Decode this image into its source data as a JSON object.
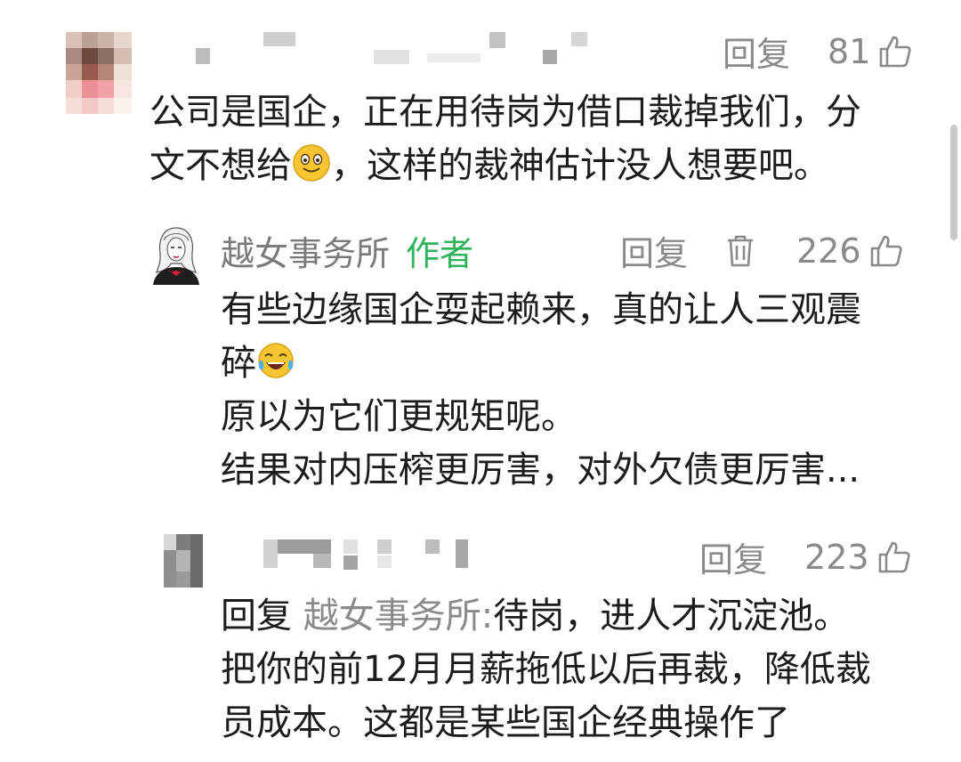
{
  "comment1": {
    "reply_label": "回复",
    "likes": "81",
    "text_line1": "公司是国企，正在用待岗为借口裁掉我们，分",
    "text_line2_a": "文不想给",
    "text_line2_b": "，这样的裁神估计没人想要吧。"
  },
  "comment2": {
    "author_name": "越女事务所",
    "author_tag": "作者",
    "reply_label": "回复",
    "likes": "226",
    "line1": "有些边缘国企耍起赖来，真的让人三观震",
    "line2": "碎",
    "line3": "原以为它们更规矩呢。",
    "line4": "结果对内压榨更厉害，对外欠债更厉害..."
  },
  "comment3": {
    "reply_label": "回复",
    "likes": "223",
    "reply_prefix": "回复",
    "reply_target": "越女事务所:",
    "line1_rest": "待岗，进人才沉淀池。",
    "line2": "把你的前12月月薪拖低以后再裁，降低裁",
    "line3": "员成本。这都是某些国企经典操作了"
  },
  "icons": {
    "like": "thumbs-up-icon",
    "delete": "trash-icon",
    "smile": "smile-emoji",
    "laugh": "laughing-tears-emoji"
  },
  "colors": {
    "author_tag": "#2fb35b",
    "meta": "#8a8a8a",
    "text": "#1c1c1c"
  }
}
